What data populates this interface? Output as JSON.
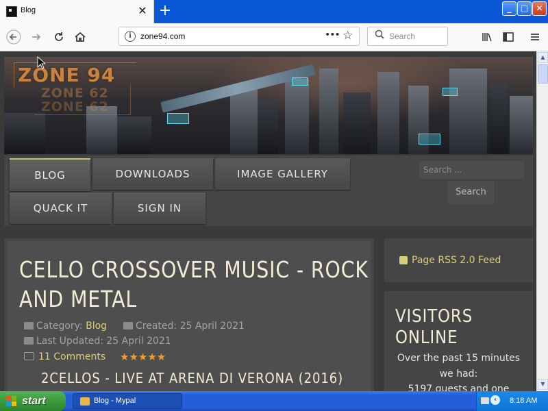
{
  "browser": {
    "tab_title": "Blog",
    "close_glyph": "✕",
    "newtab_glyph": "+",
    "url": "zone94.com",
    "search_placeholder": "Search",
    "window_buttons": {
      "minimize": "_",
      "maximize": "□",
      "close": "✕"
    }
  },
  "site": {
    "logo": {
      "main": "ZONE 94",
      "sub1": "ZONE 62",
      "sub2": "ZONE 62"
    },
    "menu": {
      "items": [
        "BLOG",
        "DOWNLOADS",
        "IMAGE GALLERY",
        "QUACK IT",
        "SIGN IN"
      ],
      "active": "BLOG"
    },
    "search": {
      "placeholder": "Search ...",
      "button": "Search"
    }
  },
  "article": {
    "title_line1": "CELLO CROSSOVER MUSIC - ROCK",
    "title_line2": "AND METAL",
    "category_label": "Category:",
    "category": "Blog",
    "created": "Created: 25 April 2021",
    "last_updated": "Last Updated: 25 April 2021",
    "comments": "11 Comments",
    "rating_stars": 5,
    "stars_text": "★★★★★",
    "subtitle": "2CELLOS - LIVE AT ARENA DI VERONA (2016)"
  },
  "sidebar": {
    "rss": "Page RSS 2.0 Feed",
    "visitors_title_1": "VISITORS",
    "visitors_title_2": "ONLINE",
    "visitors_text_1": "Over the past 15 minutes",
    "visitors_text_2": "we had:",
    "visitors_text_3": "5197 guests and one"
  },
  "taskbar": {
    "start": "start",
    "task_item": "Blog - Mypal",
    "time": "8:18 AM"
  },
  "colors": {
    "accent_gold": "#d9cf79",
    "title_text": "#f3ecd6",
    "logo_orange": "#c9833e",
    "xp_blue": "#245edb",
    "star_orange": "#f0a020"
  },
  "icons": [
    "back-icon",
    "forward-icon",
    "reload-icon",
    "home-icon",
    "info-icon",
    "more-icon",
    "bookmark-star-icon",
    "search-icon",
    "library-icon",
    "sidebar-icon",
    "menu-icon",
    "folder-icon",
    "calendar-icon",
    "comment-icon",
    "rss-icon"
  ]
}
